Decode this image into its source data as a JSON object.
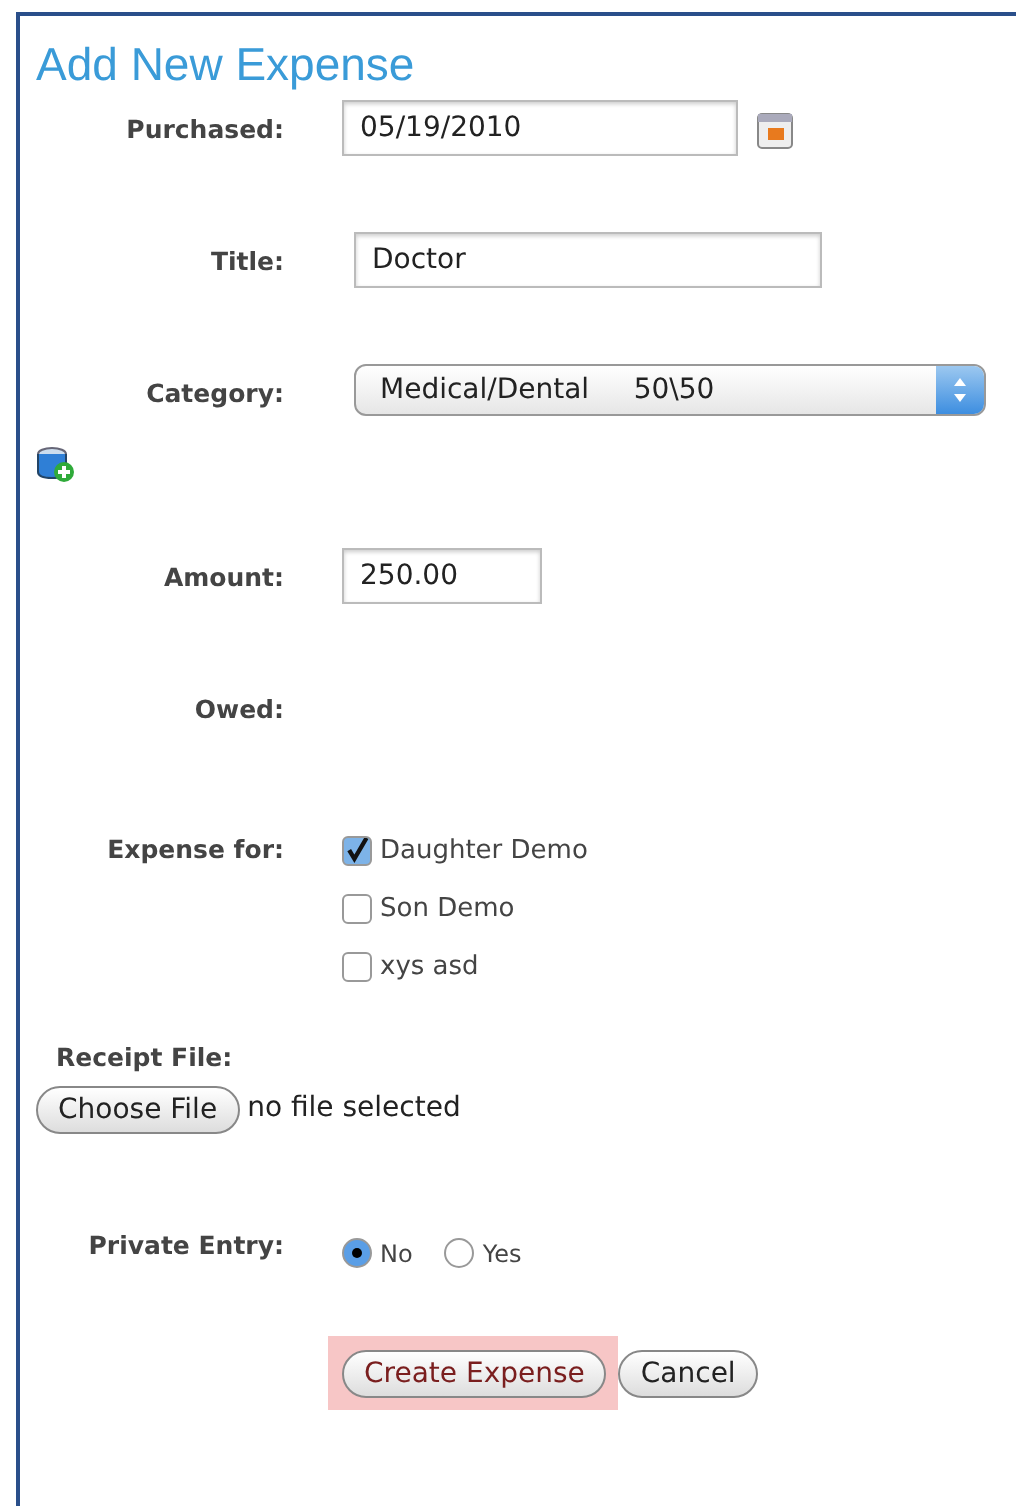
{
  "heading": "Add New Expense",
  "fields": [
    {
      "kind": "date",
      "label": "Purchased:",
      "value": "05/19/2010"
    },
    {
      "kind": "text",
      "label": "Title:",
      "value": "Doctor"
    },
    {
      "kind": "select",
      "label": "Category:",
      "value": "Medical/Dental     50\\50"
    },
    {
      "kind": "amount",
      "label": "Amount:",
      "value": "250.00"
    },
    {
      "kind": "static",
      "label": "Owed:"
    },
    {
      "kind": "checklist",
      "label": "Expense for:",
      "options": [
        {
          "label": "Daughter Demo",
          "checked": true
        },
        {
          "label": "Son Demo",
          "checked": false
        },
        {
          "label": "xys asd",
          "checked": false
        }
      ]
    },
    {
      "kind": "file",
      "label": "Receipt File:",
      "button": "Choose File",
      "status": "no file selected"
    },
    {
      "kind": "radio",
      "label": "Private Entry:",
      "options": [
        {
          "label": "No",
          "selected": true
        },
        {
          "label": "Yes",
          "selected": false
        }
      ]
    }
  ],
  "buttons": [
    {
      "label": "Create Expense",
      "kind": "primary",
      "highlighted": true
    },
    {
      "label": "Cancel",
      "kind": "secondary",
      "highlighted": false
    }
  ]
}
